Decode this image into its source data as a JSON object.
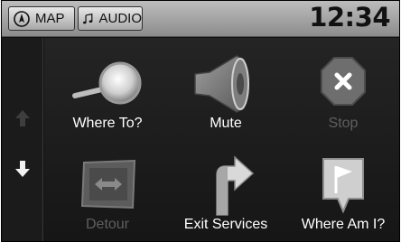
{
  "header": {
    "map_label": "MAP",
    "audio_label": "AUDIO",
    "clock": "12:34"
  },
  "menu": {
    "items": [
      {
        "label": "Where To?",
        "icon": "magnifier-icon",
        "enabled": true
      },
      {
        "label": "Mute",
        "icon": "speaker-icon",
        "enabled": true
      },
      {
        "label": "Stop",
        "icon": "stop-icon",
        "enabled": false
      },
      {
        "label": "Detour",
        "icon": "detour-icon",
        "enabled": false
      },
      {
        "label": "Exit Services",
        "icon": "exit-services-icon",
        "enabled": true
      },
      {
        "label": "Where Am I?",
        "icon": "where-am-i-flag-icon",
        "enabled": true
      }
    ]
  },
  "colors": {
    "background": "#111111",
    "topbar": "#a9a9a9",
    "label_enabled": "#ffffff",
    "label_disabled": "#5f5f5f"
  }
}
